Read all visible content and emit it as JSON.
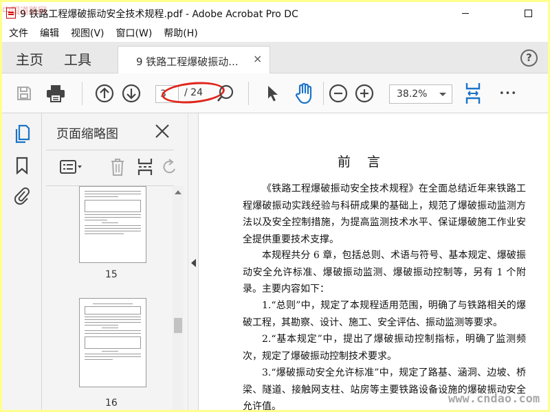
{
  "window": {
    "title": "9 铁路工程爆破振动安全技术规程.pdf - Adobe Acrobat Pro DC",
    "site_stamp": "中国道路网"
  },
  "menu": [
    "文件",
    "编辑",
    "视图(V)",
    "窗口(W)",
    "帮助(H)"
  ],
  "tabs": {
    "home": "主页",
    "tools": "工具",
    "document": "9 铁路工程爆破振动...",
    "close_glyph": "×",
    "help_glyph": "?"
  },
  "toolbar": {
    "current_page": "3",
    "total_pages": "/ 24",
    "zoom": "38.2%",
    "more_glyph": "•••"
  },
  "thumbnails": {
    "panel_title": "页面缩略图",
    "pages": [
      {
        "number": "15"
      },
      {
        "number": "16"
      }
    ]
  },
  "document": {
    "heading": "前言",
    "paragraphs": [
      "《铁路工程爆破振动安全技术规程》在全面总结近年来铁路工程爆破振动实践经验与科研成果的基础上，规范了爆破振动监测方法以及安全控制措施，为提高监测技术水平、保证爆破施工作业安全提供重要技术支撑。",
      "本规程共分 6 章，包括总则、术语与符号、基本规定、爆破振动安全允许标准、爆破振动监测、爆破振动控制等，另有 1 个附录。主要内容如下：",
      "1.“总则”中，规定了本规程适用范围，明确了与铁路相关的爆破工程，其勘察、设计、施工、安全评估、振动监测等要求。",
      "2.“基本规定”中，提出了爆破振动控制指标，明确了监测频次，规定了爆破振动控制技术要求。",
      "3.“爆破振动安全允许标准”中，规定了路基、涵洞、边坡、桥梁、隧道、接触网支柱、站房等主要铁路设备设施的爆破振动安全允许值。"
    ]
  },
  "watermark": "www.cndao.com",
  "colors": {
    "border_highlight": "#ffff8c",
    "annotation_ring": "#e0251b",
    "hand_tool": "#1a73c8"
  },
  "icons": [
    "save-icon",
    "print-icon",
    "page-up-icon",
    "page-down-icon",
    "zoom-icon",
    "select-cursor-icon",
    "hand-icon",
    "zoom-out-icon",
    "zoom-in-icon",
    "fit-page-icon",
    "more-icon",
    "thumbnails-icon",
    "bookmark-icon",
    "attachment-icon",
    "options-icon",
    "delete-icon",
    "insert-icon",
    "undo-icon"
  ]
}
